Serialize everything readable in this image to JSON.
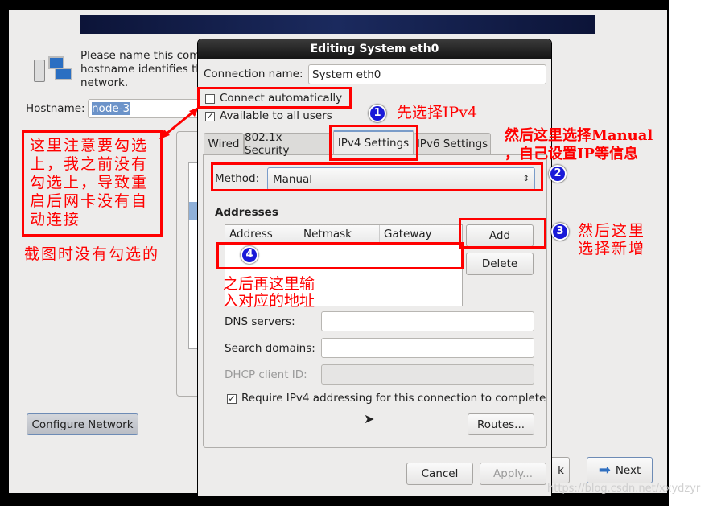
{
  "installer": {
    "intro_text": [
      "Please name this com",
      "hostname identifies th",
      "network."
    ],
    "hostname_label": "Hostname:",
    "hostname_value": "node-3",
    "configure_network": "Configure Network",
    "back_partial": "k",
    "next": "Next"
  },
  "dialog": {
    "title": "Editing System eth0",
    "connection_name_label": "Connection name:",
    "connection_name_value": "System eth0",
    "connect_automatically": {
      "label": "Connect automatically",
      "checked": false
    },
    "available_all_users": {
      "label": "Available to all users",
      "checked": true
    },
    "tabs": [
      {
        "label": "Wired"
      },
      {
        "label": "802.1x Security"
      },
      {
        "label": "IPv4 Settings",
        "active": true
      },
      {
        "label": "IPv6 Settings"
      }
    ],
    "method_label": "Method:",
    "method_value": "Manual",
    "addresses_heading": "Addresses",
    "columns": [
      "Address",
      "Netmask",
      "Gateway"
    ],
    "add": "Add",
    "delete": "Delete",
    "dns_label": "DNS servers:",
    "search_label": "Search domains:",
    "dhcp_label": "DHCP client ID:",
    "require_ipv4": {
      "label": "Require IPv4 addressing for this connection to complete",
      "checked": true
    },
    "routes": "Routes...",
    "cancel": "Cancel",
    "apply": "Apply..."
  },
  "annotations": {
    "left_note": "这里注意要勾选上，我之前没有勾选上，导致重启后网卡没有自动连接",
    "left_note2": "截图时没有勾选的",
    "n1": "1",
    "step1": "先选择IPv4",
    "n2": "2",
    "step2a": "然后这里选择Manual",
    "step2b": "，自己设置IP等信息",
    "n3": "3",
    "step3a": "然后这里",
    "step3b": "选择新增",
    "n4": "4",
    "step4a": "之后再这里输",
    "step4b": "入对应的地址"
  },
  "watermark": "https://blog.csdn.net/xxydzyr"
}
